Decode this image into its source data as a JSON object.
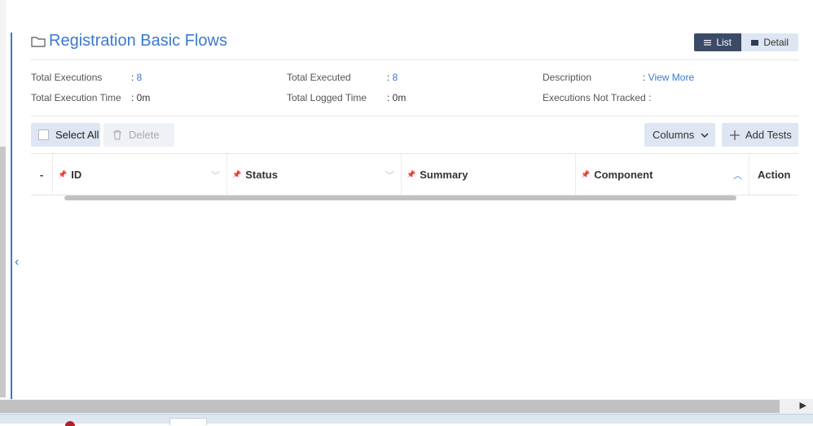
{
  "header": {
    "title": "Registration Basic Flows",
    "view_list_label": "List",
    "view_detail_label": "Detail"
  },
  "stats": {
    "total_executions_label": "Total Executions",
    "total_executions_value": "8",
    "total_execution_time_label": "Total Execution Time",
    "total_execution_time_value": "0m",
    "total_executed_label": "Total Executed",
    "total_executed_value": "8",
    "total_logged_time_label": "Total Logged Time",
    "total_logged_time_value": "0m",
    "description_label": "Description",
    "description_link": "View More",
    "executions_not_tracked_label": "Executions Not Tracked"
  },
  "toolbar": {
    "select_all_label": "Select All",
    "delete_label": "Delete",
    "columns_label": "Columns",
    "add_tests_label": "Add Tests"
  },
  "grid": {
    "columns": [
      "-",
      "ID",
      "Status",
      "Summary",
      "Component",
      "Action"
    ]
  },
  "colors": {
    "accent": "#3a79d2",
    "active_toggle": "#3b4a66",
    "button_bg": "#dde6f2"
  }
}
